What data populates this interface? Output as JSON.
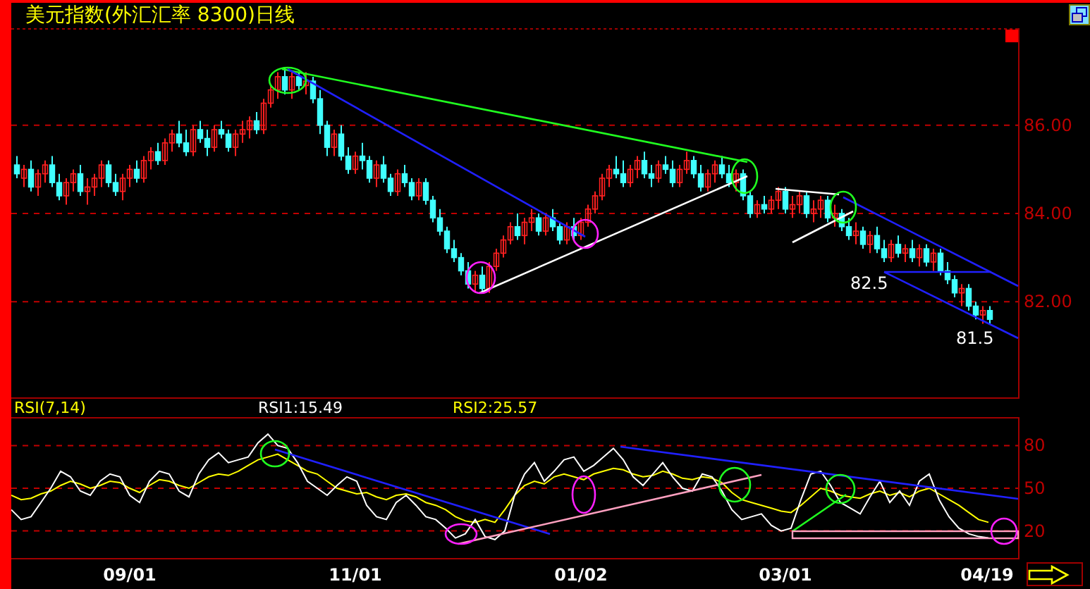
{
  "title": "美元指数(外汇汇率 8300)日线",
  "price_panel": {
    "annotations": [
      "82.5",
      "81.5"
    ],
    "chart_data": {
      "type": "candlestick",
      "ylim": [
        79.8,
        88.2
      ],
      "grid": true,
      "yticks": [
        {
          "value": 86,
          "label": "86.00"
        },
        {
          "value": 84,
          "label": "84.00"
        },
        {
          "value": 82,
          "label": "82.00"
        }
      ],
      "ohlc": [
        [
          85.1,
          85.3,
          84.8,
          84.9
        ],
        [
          84.8,
          85.1,
          84.6,
          85.0
        ],
        [
          85.0,
          85.2,
          84.5,
          84.6
        ],
        [
          84.6,
          85.0,
          84.4,
          84.9
        ],
        [
          84.9,
          85.2,
          84.7,
          85.1
        ],
        [
          85.1,
          85.3,
          84.6,
          84.7
        ],
        [
          84.7,
          84.9,
          84.3,
          84.4
        ],
        [
          84.4,
          84.8,
          84.2,
          84.7
        ],
        [
          84.7,
          85.0,
          84.5,
          84.9
        ],
        [
          84.9,
          85.1,
          84.4,
          84.5
        ],
        [
          84.5,
          84.8,
          84.2,
          84.6
        ],
        [
          84.6,
          84.9,
          84.4,
          84.8
        ],
        [
          84.8,
          85.2,
          84.6,
          85.1
        ],
        [
          85.1,
          85.2,
          84.6,
          84.7
        ],
        [
          84.7,
          84.9,
          84.4,
          84.5
        ],
        [
          84.5,
          84.9,
          84.3,
          84.8
        ],
        [
          84.8,
          85.1,
          84.6,
          85.0
        ],
        [
          85.0,
          85.2,
          84.7,
          84.8
        ],
        [
          84.8,
          85.3,
          84.7,
          85.2
        ],
        [
          85.2,
          85.5,
          85.0,
          85.4
        ],
        [
          85.4,
          85.6,
          85.1,
          85.2
        ],
        [
          85.2,
          85.7,
          85.1,
          85.6
        ],
        [
          85.6,
          85.9,
          85.4,
          85.8
        ],
        [
          85.8,
          86.1,
          85.5,
          85.6
        ],
        [
          85.6,
          85.9,
          85.3,
          85.4
        ],
        [
          85.4,
          86.0,
          85.3,
          85.9
        ],
        [
          85.9,
          86.1,
          85.6,
          85.7
        ],
        [
          85.7,
          85.9,
          85.3,
          85.5
        ],
        [
          85.5,
          86.0,
          85.4,
          85.9
        ],
        [
          85.9,
          86.1,
          85.7,
          85.8
        ],
        [
          85.8,
          85.9,
          85.4,
          85.5
        ],
        [
          85.5,
          85.9,
          85.3,
          85.8
        ],
        [
          85.8,
          86.1,
          85.6,
          85.9
        ],
        [
          85.9,
          86.2,
          85.7,
          86.1
        ],
        [
          86.1,
          86.3,
          85.8,
          85.9
        ],
        [
          85.9,
          86.6,
          85.8,
          86.5
        ],
        [
          86.5,
          86.9,
          86.4,
          86.8
        ],
        [
          86.8,
          87.2,
          86.6,
          87.1
        ],
        [
          87.1,
          87.3,
          86.7,
          86.8
        ],
        [
          86.8,
          87.2,
          86.6,
          87.1
        ],
        [
          87.1,
          87.2,
          86.8,
          86.9
        ],
        [
          86.9,
          87.2,
          86.7,
          87.0
        ],
        [
          87.0,
          87.1,
          86.5,
          86.6
        ],
        [
          86.6,
          86.8,
          85.8,
          86.0
        ],
        [
          86.0,
          86.1,
          85.3,
          85.5
        ],
        [
          85.5,
          85.9,
          85.3,
          85.8
        ],
        [
          85.8,
          86.0,
          85.2,
          85.3
        ],
        [
          85.3,
          85.5,
          84.9,
          85.0
        ],
        [
          85.0,
          85.4,
          84.9,
          85.3
        ],
        [
          85.3,
          85.6,
          85.0,
          85.2
        ],
        [
          85.2,
          85.3,
          84.7,
          84.8
        ],
        [
          84.8,
          85.2,
          84.6,
          85.1
        ],
        [
          85.1,
          85.3,
          84.7,
          84.8
        ],
        [
          84.8,
          84.9,
          84.4,
          84.5
        ],
        [
          84.5,
          85.0,
          84.4,
          84.9
        ],
        [
          84.9,
          85.1,
          84.6,
          84.7
        ],
        [
          84.7,
          84.8,
          84.3,
          84.4
        ],
        [
          84.4,
          84.8,
          84.3,
          84.7
        ],
        [
          84.7,
          84.8,
          84.2,
          84.3
        ],
        [
          84.3,
          84.4,
          83.8,
          83.9
        ],
        [
          83.9,
          84.1,
          83.5,
          83.6
        ],
        [
          83.6,
          83.7,
          83.1,
          83.2
        ],
        [
          83.2,
          83.4,
          82.9,
          83.0
        ],
        [
          83.0,
          83.1,
          82.6,
          82.7
        ],
        [
          82.7,
          82.9,
          82.3,
          82.4
        ],
        [
          82.4,
          82.7,
          82.2,
          82.6
        ],
        [
          82.6,
          82.8,
          82.2,
          82.3
        ],
        [
          82.3,
          82.9,
          82.2,
          82.8
        ],
        [
          82.8,
          83.2,
          82.7,
          83.1
        ],
        [
          83.1,
          83.5,
          83.0,
          83.4
        ],
        [
          83.4,
          83.8,
          83.3,
          83.7
        ],
        [
          83.7,
          84.0,
          83.4,
          83.5
        ],
        [
          83.5,
          83.9,
          83.3,
          83.8
        ],
        [
          83.8,
          84.1,
          83.6,
          83.9
        ],
        [
          83.9,
          84.0,
          83.5,
          83.6
        ],
        [
          83.6,
          84.0,
          83.5,
          83.9
        ],
        [
          83.9,
          84.1,
          83.6,
          83.7
        ],
        [
          83.7,
          83.8,
          83.3,
          83.4
        ],
        [
          83.4,
          83.8,
          83.3,
          83.7
        ],
        [
          83.7,
          83.9,
          83.4,
          83.5
        ],
        [
          83.5,
          83.9,
          83.4,
          83.8
        ],
        [
          83.8,
          84.2,
          83.7,
          84.1
        ],
        [
          84.1,
          84.5,
          84.0,
          84.4
        ],
        [
          84.4,
          84.9,
          84.3,
          84.8
        ],
        [
          84.8,
          85.1,
          84.6,
          85.0
        ],
        [
          85.0,
          85.3,
          84.8,
          84.9
        ],
        [
          84.9,
          85.2,
          84.6,
          84.7
        ],
        [
          84.7,
          85.1,
          84.6,
          85.0
        ],
        [
          85.0,
          85.3,
          84.8,
          85.2
        ],
        [
          85.2,
          85.4,
          84.8,
          84.9
        ],
        [
          84.9,
          85.1,
          84.6,
          84.8
        ],
        [
          84.8,
          85.2,
          84.7,
          85.1
        ],
        [
          85.1,
          85.3,
          84.9,
          85.0
        ],
        [
          85.0,
          85.2,
          84.6,
          84.7
        ],
        [
          84.7,
          85.1,
          84.6,
          85.0
        ],
        [
          85.0,
          85.4,
          84.9,
          85.2
        ],
        [
          85.2,
          85.3,
          84.8,
          84.9
        ],
        [
          84.9,
          85.1,
          84.5,
          84.6
        ],
        [
          84.6,
          85.0,
          84.5,
          84.9
        ],
        [
          84.9,
          85.2,
          84.7,
          85.1
        ],
        [
          85.1,
          85.3,
          84.8,
          84.9
        ],
        [
          84.9,
          85.1,
          84.6,
          84.7
        ],
        [
          84.7,
          85.0,
          84.5,
          84.9
        ],
        [
          84.9,
          85.0,
          84.3,
          84.4
        ],
        [
          84.4,
          84.5,
          83.9,
          84.0
        ],
        [
          84.0,
          84.3,
          83.9,
          84.2
        ],
        [
          84.2,
          84.4,
          84.0,
          84.1
        ],
        [
          84.1,
          84.4,
          84.0,
          84.3
        ],
        [
          84.3,
          84.6,
          84.1,
          84.5
        ],
        [
          84.5,
          84.6,
          84.0,
          84.1
        ],
        [
          84.1,
          84.4,
          83.9,
          84.2
        ],
        [
          84.2,
          84.5,
          84.0,
          84.4
        ],
        [
          84.4,
          84.5,
          83.9,
          84.0
        ],
        [
          84.0,
          84.3,
          83.8,
          84.1
        ],
        [
          84.1,
          84.4,
          83.9,
          84.3
        ],
        [
          84.3,
          84.4,
          83.8,
          83.9
        ],
        [
          83.9,
          84.2,
          83.7,
          84.0
        ],
        [
          84.0,
          84.1,
          83.6,
          83.7
        ],
        [
          83.7,
          83.9,
          83.4,
          83.5
        ],
        [
          83.5,
          83.8,
          83.3,
          83.6
        ],
        [
          83.6,
          83.7,
          83.2,
          83.3
        ],
        [
          83.3,
          83.6,
          83.1,
          83.5
        ],
        [
          83.5,
          83.7,
          83.1,
          83.2
        ],
        [
          83.2,
          83.4,
          82.9,
          83.0
        ],
        [
          83.0,
          83.4,
          82.9,
          83.3
        ],
        [
          83.3,
          83.5,
          83.0,
          83.1
        ],
        [
          83.1,
          83.3,
          82.9,
          83.2
        ],
        [
          83.2,
          83.4,
          82.9,
          83.0
        ],
        [
          83.0,
          83.3,
          82.8,
          83.2
        ],
        [
          83.2,
          83.3,
          82.8,
          82.9
        ],
        [
          82.9,
          83.2,
          82.7,
          83.1
        ],
        [
          83.1,
          83.2,
          82.6,
          82.7
        ],
        [
          82.7,
          82.9,
          82.4,
          82.5
        ],
        [
          82.5,
          82.6,
          82.1,
          82.2
        ],
        [
          82.2,
          82.4,
          81.9,
          82.3
        ],
        [
          82.3,
          82.4,
          81.8,
          81.9
        ],
        [
          81.9,
          82.0,
          81.6,
          81.7
        ],
        [
          81.7,
          81.9,
          81.5,
          81.8
        ],
        [
          81.8,
          81.9,
          81.5,
          81.6
        ]
      ]
    }
  },
  "date_labels": [
    "09/01",
    "11/01",
    "01/02",
    "03/01",
    "04/19"
  ],
  "rsi_panel": {
    "name": "RSI(7,14)",
    "rsi1": "RSI1:15.49",
    "rsi2": "RSI2:25.57",
    "chart_data": {
      "type": "line",
      "ylim": [
        0,
        100
      ],
      "grid": true,
      "yticks": [
        {
          "value": 80,
          "label": "80"
        },
        {
          "value": 50,
          "label": "50"
        },
        {
          "value": 20,
          "label": "20"
        }
      ],
      "series": [
        {
          "color": "#ffffff",
          "values": [
            35,
            28,
            30,
            40,
            50,
            62,
            58,
            48,
            45,
            55,
            60,
            58,
            45,
            40,
            55,
            62,
            60,
            48,
            44,
            60,
            70,
            75,
            68,
            70,
            72,
            82,
            88,
            80,
            78,
            68,
            55,
            50,
            45,
            52,
            58,
            55,
            38,
            30,
            28,
            40,
            45,
            38,
            30,
            28,
            22,
            15,
            18,
            28,
            16,
            14,
            20,
            45,
            60,
            68,
            55,
            62,
            70,
            72,
            62,
            66,
            72,
            78,
            70,
            58,
            52,
            60,
            68,
            58,
            50,
            48,
            60,
            58,
            48,
            35,
            28,
            30,
            32,
            24,
            20,
            22,
            42,
            60,
            62,
            52,
            40,
            36,
            32,
            44,
            55,
            40,
            48,
            38,
            55,
            60,
            42,
            30,
            22,
            18,
            16,
            15
          ]
        },
        {
          "color": "#ffff00",
          "values": [
            45,
            42,
            43,
            46,
            48,
            52,
            55,
            53,
            50,
            52,
            55,
            54,
            50,
            47,
            52,
            56,
            55,
            52,
            50,
            54,
            58,
            60,
            59,
            62,
            66,
            70,
            72,
            74,
            70,
            66,
            62,
            60,
            55,
            50,
            48,
            46,
            47,
            44,
            42,
            45,
            46,
            44,
            40,
            38,
            35,
            30,
            27,
            26,
            28,
            26,
            35,
            45,
            52,
            55,
            53,
            58,
            60,
            58,
            56,
            60,
            62,
            64,
            63,
            60,
            58,
            59,
            62,
            60,
            57,
            56,
            58,
            57,
            54,
            47,
            42,
            40,
            38,
            36,
            34,
            33,
            38,
            44,
            50,
            48,
            45,
            44,
            43,
            46,
            48,
            45,
            47,
            44,
            48,
            50,
            46,
            42,
            38,
            33,
            28,
            26
          ]
        }
      ]
    }
  }
}
